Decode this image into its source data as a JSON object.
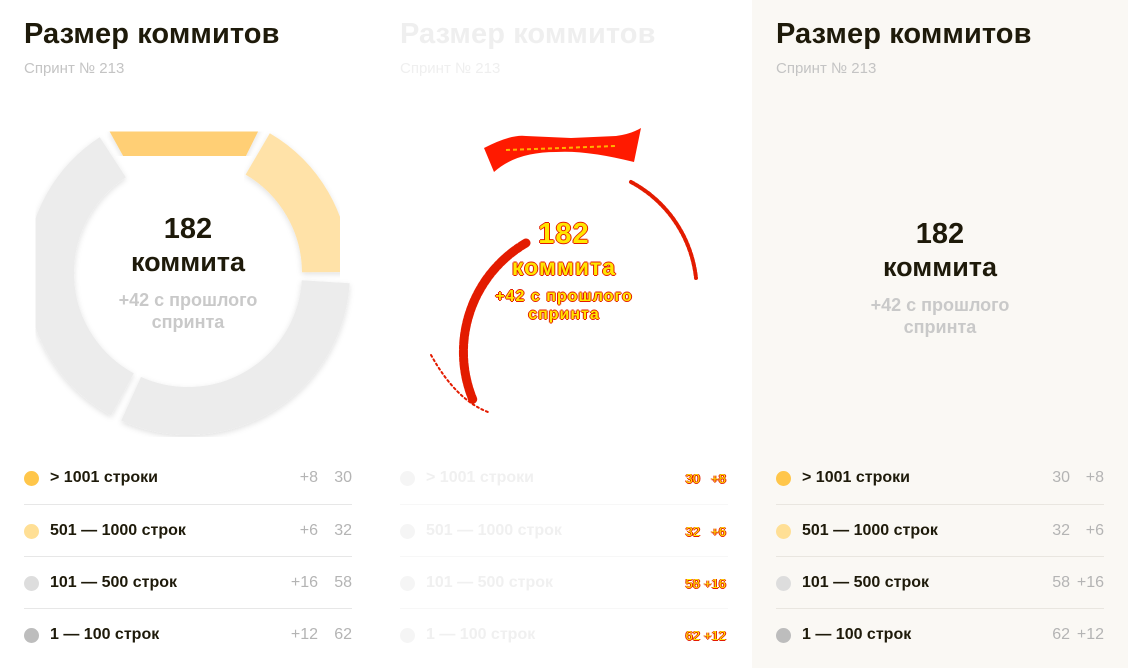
{
  "chart_data": [
    {
      "type": "pie",
      "title": "Размер коммитов",
      "subtitle": "Спринт № 213",
      "center_count": "182",
      "center_word": "коммита",
      "center_delta_line1": "+42 с прошлого",
      "center_delta_line2": "спринта",
      "categories": [
        "> 1001 строки",
        "501 — 1000 строк",
        "101 — 500 строк",
        "1 — 100 строк"
      ],
      "values": [
        30,
        32,
        58,
        62
      ],
      "deltas": [
        "+8",
        "+6",
        "+16",
        "+12"
      ],
      "colors": [
        "#ffc64a",
        "#ffdf95",
        "#dddddd",
        "#bdbdbd"
      ],
      "ring_colors": [
        "#ffcf74",
        "#ffe2a8",
        "#ececec",
        "#ececec"
      ]
    },
    {
      "type": "pie",
      "title": "Размер коммитов",
      "subtitle": "Спринт № 213",
      "center_count": "182",
      "center_word": "коммита",
      "center_delta_line1": "+42 с прошлого",
      "center_delta_line2": "спринта",
      "categories": [
        "> 1001 строки",
        "501 — 1000 строк",
        "101 — 500 строк",
        "1 — 100 строк"
      ],
      "values": [
        "30",
        "32",
        "58",
        "62"
      ],
      "deltas": [
        "+8",
        "+6",
        "+16",
        "+12"
      ],
      "colors": [
        "#f5f5f5",
        "#f5f5f5",
        "#f5f5f5",
        "#f5f5f5"
      ]
    },
    {
      "type": "pie",
      "title": "Размер коммитов",
      "subtitle": "Спринт № 213",
      "center_count": "182",
      "center_word": "коммита",
      "center_delta_line1": "+42 с прошлого",
      "center_delta_line2": "спринта",
      "categories": [
        "> 1001 строки",
        "501 — 1000 строк",
        "101 — 500 строк",
        "1 — 100 строк"
      ],
      "values": [
        30,
        32,
        58,
        62
      ],
      "deltas": [
        "+8",
        "+6",
        "+16",
        "+12"
      ],
      "colors": [
        "#ffc64a",
        "#ffdf95",
        "#dddddd",
        "#bdbdbd"
      ]
    }
  ]
}
